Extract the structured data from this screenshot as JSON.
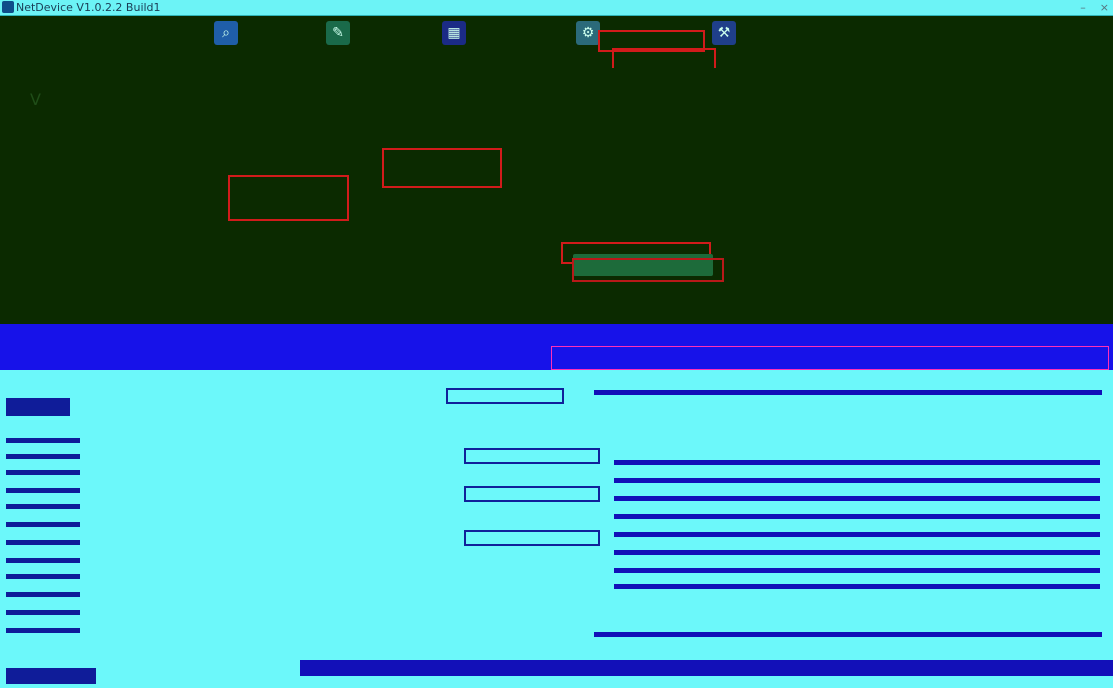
{
  "window": {
    "title": "NetDevice V1.0.2.2 Build1"
  },
  "toolbar": {
    "left_label": "",
    "items": [
      {
        "label": "",
        "icon": "search-icon"
      },
      {
        "label": "",
        "icon": "edit-icon"
      },
      {
        "label": "",
        "icon": "device-icon"
      },
      {
        "label": "",
        "icon": "config-icon"
      },
      {
        "label": "",
        "icon": "tools-icon"
      }
    ],
    "right_label": ""
  },
  "content": {
    "line1": "V",
    "line2": "",
    "row_label": "",
    "row_value": "",
    "button_label": ""
  },
  "band": {
    "title": "",
    "subtitle": "",
    "box_text": ""
  },
  "form": {
    "rows": [
      {
        "label": "",
        "value": ""
      },
      {
        "label": "",
        "value": ""
      },
      {
        "label": "",
        "value": ""
      },
      {
        "label": "",
        "value": ""
      }
    ]
  },
  "right_panel": {
    "header": "",
    "description": ""
  },
  "colors": {
    "dark_bg": "#0b2a00",
    "titlebar": "#6cf3f6",
    "band_blue": "#1712e9",
    "accent_red": "#d11b1b",
    "cyan_area": "#6cf8fa",
    "navy": "#10219a"
  }
}
